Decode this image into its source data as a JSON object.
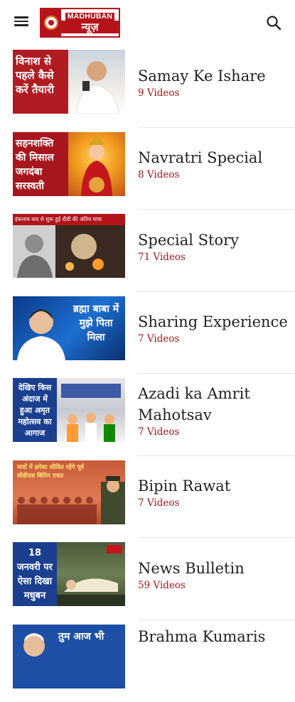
{
  "header": {
    "logo_line1": "MADHUBAN",
    "logo_line2": "न्यूज़",
    "menu_icon": "hamburger-menu-icon",
    "search_icon": "search-icon"
  },
  "playlists": [
    {
      "title": "Samay Ke Ishare",
      "count": "9 Videos",
      "thumb_text": "विनाश से पहले कैसे करें तैयारी"
    },
    {
      "title": "Navratri Special",
      "count": "8 Videos",
      "thumb_text": "सहनशक्ति की मिसाल जगदंबा सरस्वती"
    },
    {
      "title": "Special Story",
      "count": "71 Videos",
      "thumb_text": "इंकलाब बाद से शुरू हुई दीदी की अंतिम यात्रा"
    },
    {
      "title": "Sharing Experience",
      "count": "7 Videos",
      "thumb_text": "ब्रह्मा बाबा में मुझे पिता मिला"
    },
    {
      "title": "Azadi ka Amrit Mahotsav",
      "count": "7 Videos",
      "thumb_text": "देखिए किस अंदाज में हुआ अमृत महोत्सव का आगाज"
    },
    {
      "title": "Bipin Rawat",
      "count": "7 Videos",
      "thumb_text": "यादों में हमेशा जीवित रहेंगे पूर्व सीडीएस बिपिन रावत"
    },
    {
      "title": "News Bulletin",
      "count": "59 Videos",
      "thumb_text": "18 जनवरी पर ऐसा दिखा मधुबन"
    },
    {
      "title": "Brahma Kumaris",
      "count": "",
      "thumb_text": "तुम आज भी"
    }
  ],
  "colors": {
    "brand_red": "#b5131a",
    "count_red": "#a3151b"
  }
}
